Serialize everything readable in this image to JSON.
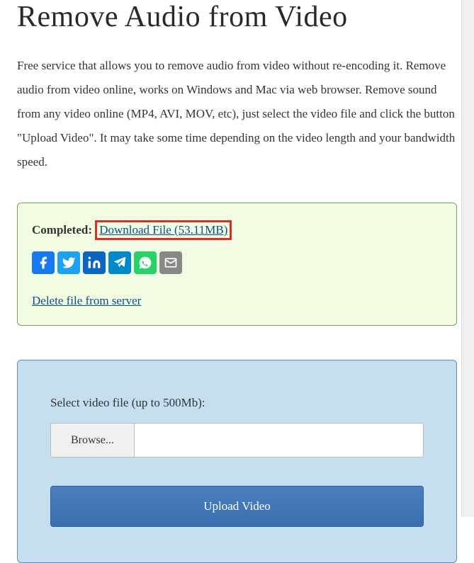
{
  "page": {
    "title": "Remove Audio from Video",
    "description": "Free service that allows you to remove audio from video without re-encoding it. Remove audio from video online, works on Windows and Mac via web browser. Remove sound from any video online (MP4, AVI, MOV, etc), just select the video file and click the button \"Upload Video\". It may take some time depending on the video length and your bandwidth speed."
  },
  "status": {
    "label": "Completed:",
    "download_text": "Download File (53.11MB)",
    "delete_text": "Delete file from server"
  },
  "social": {
    "facebook": "facebook",
    "twitter": "twitter",
    "linkedin": "linkedin",
    "telegram": "telegram",
    "whatsapp": "whatsapp",
    "email": "email"
  },
  "upload": {
    "label": "Select video file (up to 500Mb):",
    "browse_label": "Browse...",
    "file_name": "",
    "button_label": "Upload Video"
  }
}
